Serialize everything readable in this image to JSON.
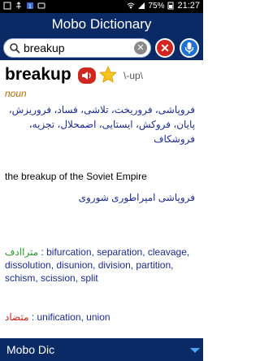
{
  "status_bar": {
    "battery": "75%",
    "time": "21:27"
  },
  "app_title": "Mobo Dictionary",
  "search": {
    "value": "breakup"
  },
  "entry": {
    "headword": "breakup",
    "pronunciation": "\\-up\\",
    "part_of_speech": "noun",
    "persian_meaning": "فروپاشی، فروریخت، تلاشی، فساد، فروریزش، پایان، فروکش، ایستایی، اضمحلال، تجزیه، فروشکاف",
    "example_en": "the breakup of the Soviet Empire",
    "example_fa": "فروپاشی امپراطوری شوروی"
  },
  "synonyms": {
    "label": "متراادف",
    "text": " : bifurcation, separation, cleavage, dissolution, disunion, division, partition, schism, scission, split"
  },
  "antonyms": {
    "label": "متضاد",
    "text": " : unification, union"
  },
  "bottom_bar": {
    "title": "Mobo Dic"
  },
  "colors": {
    "primary": "#0a2a66",
    "translation": "#1a2a9a",
    "pos": "#c06a00",
    "synonym_label": "#2a9a2a",
    "antonym_label": "#c8261d"
  }
}
